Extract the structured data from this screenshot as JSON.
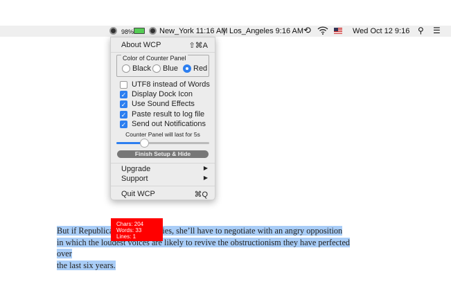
{
  "menubar": {
    "battery": "98%",
    "clock1": "New_York 11:16 AM",
    "divider": "|",
    "clock2": "Los_Angeles 9:16 AM",
    "datetime": "Wed Oct 12  9:16",
    "icons": [
      "wcp-icon",
      "battery-icon",
      "clock-app-icon",
      "time-machine-icon",
      "wifi-icon",
      "us-flag-icon",
      "spotlight-search-icon",
      "notification-center-icon"
    ]
  },
  "menu": {
    "about": {
      "label": "About WCP",
      "shortcut": "⇧⌘A"
    },
    "color_group": {
      "label": "Color of Counter Panel",
      "options": [
        "Black",
        "Blue",
        "Red"
      ],
      "selected": "Red"
    },
    "checkboxes": [
      {
        "label": "UTF8 instead of Words",
        "checked": false
      },
      {
        "label": "Display Dock Icon",
        "checked": true
      },
      {
        "label": "Use Sound Effects",
        "checked": true
      },
      {
        "label": "Paste result to log file",
        "checked": true
      },
      {
        "label": "Send out Notifications",
        "checked": true
      }
    ],
    "slider_label": "Counter Panel will last for 5s",
    "slider_value_fraction": 0.3,
    "finish_button": "Finish Setup & Hide",
    "upgrade": "Upgrade",
    "support": "Support",
    "submenu_arrow": "▶",
    "quit": {
      "label": "Quit WCP",
      "shortcut": "⌘Q"
    }
  },
  "document": {
    "lines": [
      "But if Republicans win majorities, she’ll have to negotiate with an angry opposition",
      "in which the loudest voices are likely to revive the obstructionism they have perfected over",
      "the last six years."
    ]
  },
  "counter_panel": {
    "chars": "Chars: 204",
    "words": "Words: 33",
    "lines": "Lines: 1",
    "color": "#ff0000"
  }
}
